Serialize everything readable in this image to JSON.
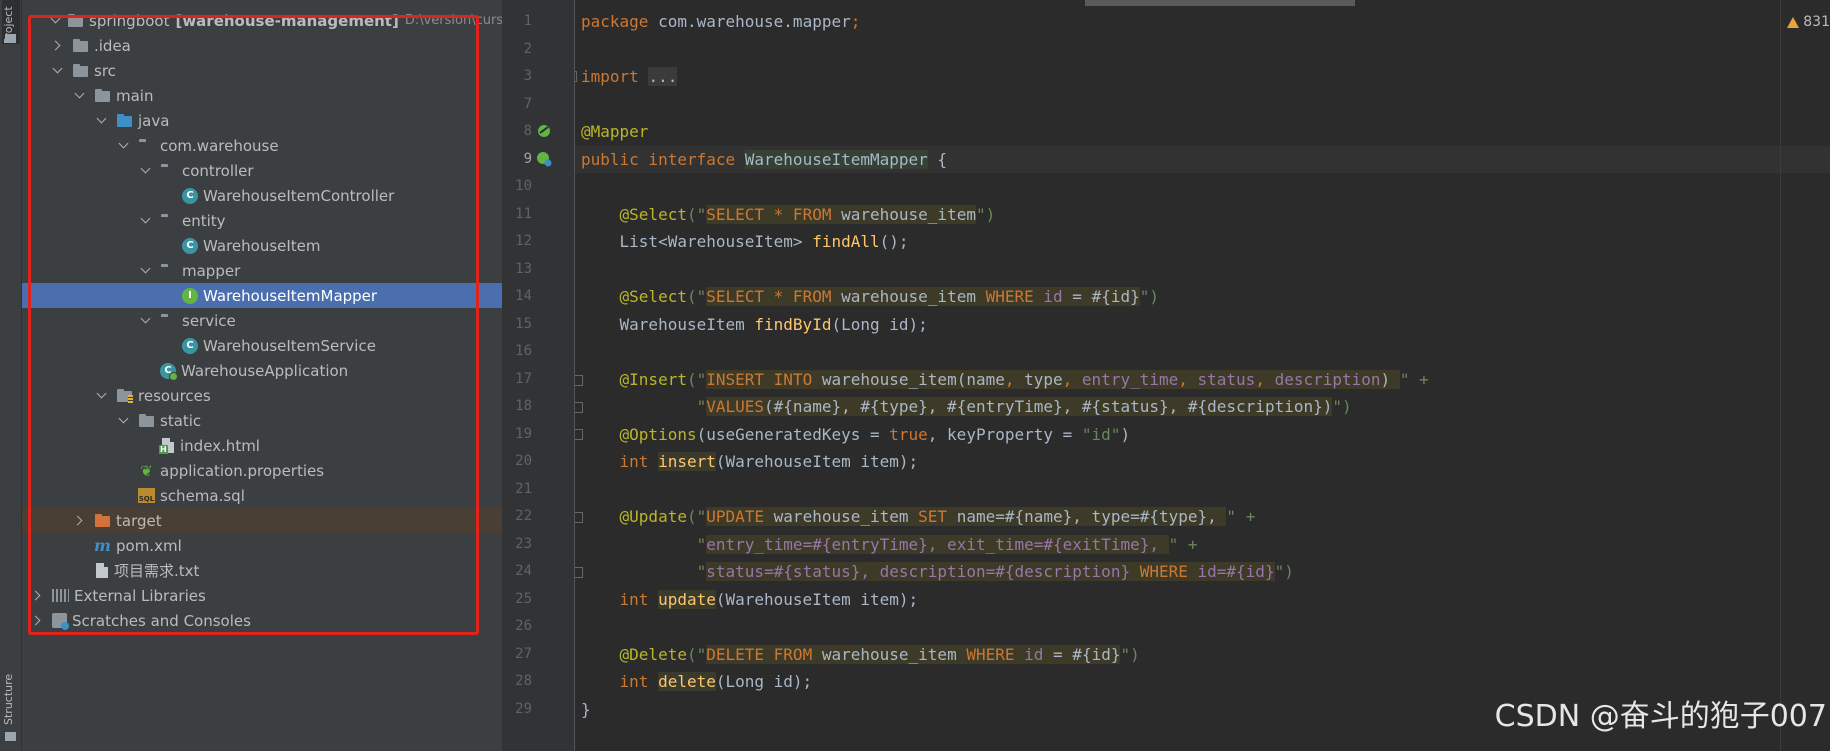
{
  "tool_strip": {
    "project_tab": "Project",
    "structure_tab": "Structure"
  },
  "project_tree": {
    "root": {
      "name": "springboot",
      "module": "[warehouse-management]",
      "path": "D:\\version\\cursor"
    },
    "items": [
      {
        "label": ".idea",
        "icon": "folder-icon"
      },
      {
        "label": "src",
        "icon": "folder-icon"
      },
      {
        "label": "main",
        "icon": "folder-icon"
      },
      {
        "label": "java",
        "icon": "source-folder-icon"
      },
      {
        "label": "com.warehouse",
        "icon": "package-icon"
      },
      {
        "label": "controller",
        "icon": "package-icon"
      },
      {
        "label": "WarehouseItemController",
        "icon": "class-icon"
      },
      {
        "label": "entity",
        "icon": "package-icon"
      },
      {
        "label": "WarehouseItem",
        "icon": "class-icon"
      },
      {
        "label": "mapper",
        "icon": "package-icon"
      },
      {
        "label": "WarehouseItemMapper",
        "icon": "interface-icon"
      },
      {
        "label": "service",
        "icon": "package-icon"
      },
      {
        "label": "WarehouseItemService",
        "icon": "class-icon"
      },
      {
        "label": "WarehouseApplication",
        "icon": "spring-app-icon"
      },
      {
        "label": "resources",
        "icon": "resources-folder-icon"
      },
      {
        "label": "static",
        "icon": "folder-icon"
      },
      {
        "label": "index.html",
        "icon": "html-file-icon"
      },
      {
        "label": "application.properties",
        "icon": "spring-properties-icon"
      },
      {
        "label": "schema.sql",
        "icon": "sql-file-icon"
      },
      {
        "label": "target",
        "icon": "excluded-folder-icon"
      },
      {
        "label": "pom.xml",
        "icon": "maven-icon"
      },
      {
        "label": "项目需求.txt",
        "icon": "text-file-icon"
      },
      {
        "label": "External Libraries",
        "icon": "libraries-icon"
      },
      {
        "label": "Scratches and Consoles",
        "icon": "scratches-icon"
      }
    ],
    "selected": "WarehouseItemMapper"
  },
  "editor": {
    "line_numbers": [
      "1",
      "2",
      "3",
      "7",
      "8",
      "9",
      "10",
      "11",
      "12",
      "13",
      "14",
      "15",
      "16",
      "17",
      "18",
      "19",
      "20",
      "21",
      "22",
      "23",
      "24",
      "25",
      "26",
      "27",
      "28",
      "29"
    ],
    "current_line": "9",
    "warnings": "831",
    "code": {
      "l1_kw": "package",
      "l1_rest": " com.warehouse.mapper",
      "l1_semi": ";",
      "l3_kw": "import",
      "l3_dots": "...",
      "l8_ann": "@Mapper",
      "l9_kw": "public interface",
      "l9_name": "WarehouseItemMapper",
      "l9_rest": " {",
      "select": "@Select",
      "open_q": "(\"",
      "close_q": "\")",
      "sel_kw": "SELECT * FROM",
      "table": " warehouse_item",
      "l12_type": "List<WarehouseItem> ",
      "l12_fn": "findAll",
      "l12_rest": "();",
      "where": " WHERE",
      "id_col": " id",
      "eq_id": " = #{id}",
      "l15_type": "WarehouseItem ",
      "l15_fn": "findById",
      "l15_rest": "(Long id);",
      "insert_ann": "@Insert",
      "ins_kw": "INSERT INTO",
      "ins_table": " warehouse_item(name",
      "ins_c1": ", ",
      "ins_type": "type",
      "ins_c2": ", ",
      "ins_entry": "entry_time",
      "ins_c3": ", ",
      "ins_status": "status",
      "ins_c4": ", ",
      "ins_desc": "description",
      "ins_end": ") ",
      "quote_plus": "\" +",
      "l18_q": "\"",
      "l18_values": "VALUES",
      "l18_rest": "(#{name}, #{type}, #{entryTime}, #{status}, #{description})",
      "l18_close": "\")",
      "options_ann": "@Options",
      "l19_a": "(useGeneratedKeys = ",
      "l19_true": "true",
      "l19_b": ", keyProperty = ",
      "l19_str": "\"id\"",
      "l19_c": ")",
      "int_kw": "int ",
      "l20_fn": "insert",
      "item_param": "(WarehouseItem item);",
      "update_ann": "@Update",
      "upd_kw": "UPDATE",
      "upd_table": " warehouse_item",
      "upd_set": " SET",
      "upd_rest": " name=#{name}, type=#{type}, ",
      "l23_text": "entry_time=#{entryTime}, exit_time=#{exitTime}, ",
      "l24_text": "status=#{status}, description=#{description}",
      "l24_where": " WHERE",
      "l24_id": " id=#{id}",
      "l25_fn": "update",
      "delete_ann": "@Delete",
      "del_kw": "DELETE FROM",
      "l28_fn": "delete",
      "long_param": "(Long id);",
      "l29": "}"
    }
  },
  "watermark": "CSDN @奋斗的狍子007"
}
